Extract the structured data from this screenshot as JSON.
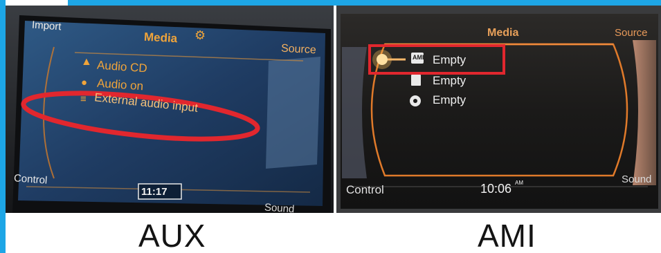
{
  "left_screen": {
    "import_label": "Import",
    "title": "Media",
    "source_label": "Source",
    "menu_items": [
      {
        "label": "Audio CD",
        "icon": "cd-icon"
      },
      {
        "label": "Audio on",
        "icon": "disc-icon"
      },
      {
        "label": "External audio input",
        "icon": "aux-input-icon"
      }
    ],
    "control_label": "Control",
    "clock": "11:17",
    "sound_label": "Sound",
    "highlight_color": "#d8242b",
    "text_color": "#f0a43a"
  },
  "right_screen": {
    "title": "Media",
    "source_label": "Source",
    "menu_items": [
      {
        "label": "Empty",
        "icon": "ami-icon"
      },
      {
        "label": "Empty",
        "icon": "sd-card-icon"
      },
      {
        "label": "Empty",
        "icon": "disc-icon"
      }
    ],
    "control_label": "Control",
    "clock": "10:06",
    "clock_suffix": "AM",
    "sound_label": "Sound",
    "highlight_color": "#d8242b",
    "frame_color": "#e07a2a"
  },
  "captions": {
    "left": "AUX",
    "right": "AMI"
  },
  "colors": {
    "accent": "#1da6e6",
    "caption_text": "#141414"
  }
}
